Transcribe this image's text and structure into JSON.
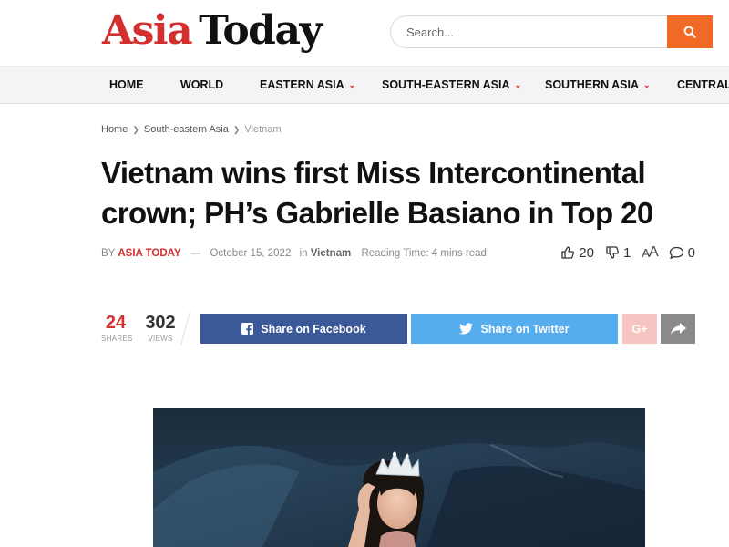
{
  "logo": {
    "part1": "Asia",
    "part2": "Today"
  },
  "search": {
    "placeholder": "Search..."
  },
  "nav": {
    "items": [
      {
        "label": "HOME",
        "has_dropdown": false
      },
      {
        "label": "WORLD",
        "has_dropdown": false
      },
      {
        "label": "EASTERN ASIA",
        "has_dropdown": true
      },
      {
        "label": "SOUTH-EASTERN ASIA",
        "has_dropdown": true
      },
      {
        "label": "SOUTHERN ASIA",
        "has_dropdown": true
      },
      {
        "label": "CENTRAL A",
        "has_dropdown": false
      }
    ]
  },
  "breadcrumb": {
    "items": [
      "Home",
      "South-eastern Asia",
      "Vietnam"
    ]
  },
  "article": {
    "title": "Vietnam wins first Miss Intercontinental crown; PH’s Gabrielle Basiano in Top 20",
    "by": "BY",
    "author": "ASIA TODAY",
    "dash": "—",
    "date": "October 15, 2022",
    "in": "in",
    "category": "Vietnam",
    "reading_time": "Reading Time: 4 mins read",
    "likes": "20",
    "dislikes": "1",
    "font_size_label_small": "A",
    "font_size_label_big": "A",
    "comments": "0"
  },
  "share": {
    "shares_count": "24",
    "shares_label": "SHARES",
    "views_count": "302",
    "views_label": "VIEWS",
    "facebook_label": "Share on Facebook",
    "twitter_label": "Share on Twitter",
    "googleplus_label": "G+"
  },
  "colors": {
    "accent_red": "#d32f2f",
    "search_orange": "#f06a25",
    "facebook": "#3b5998",
    "twitter": "#55acee"
  }
}
